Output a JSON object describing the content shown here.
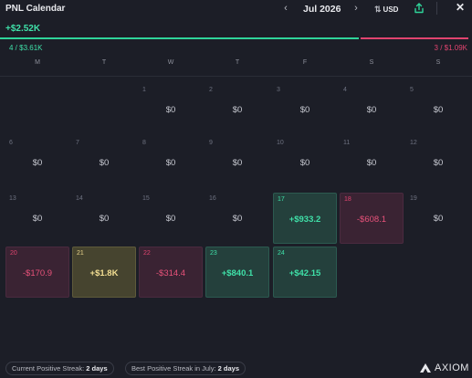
{
  "header": {
    "title": "PNL Calendar",
    "month": "Jul 2026",
    "currency": "USD",
    "prev_icon": "chevron-left-icon",
    "next_icon": "chevron-right-icon",
    "currency_icon": "swap-vertical-icon",
    "share_icon": "share-icon",
    "close_icon": "close-icon"
  },
  "summary": {
    "total": "+$2.52K",
    "wins": "4 / $3.61K",
    "losses": "3 / $1.09K",
    "win_share": 0.768,
    "colors": {
      "positive": "#2fd49a",
      "negative": "#e0446f",
      "highlight": "#f3de92"
    }
  },
  "weekdays": [
    "M",
    "T",
    "W",
    "T",
    "F",
    "S",
    "S"
  ],
  "weeks": [
    [
      {
        "d": "1",
        "v": "$0",
        "s": "zero",
        "c": 2
      },
      {
        "d": "2",
        "v": "$0",
        "s": "zero",
        "c": 3
      },
      {
        "d": "3",
        "v": "$0",
        "s": "zero",
        "c": 4
      },
      {
        "d": "4",
        "v": "$0",
        "s": "zero",
        "c": 5
      },
      {
        "d": "5",
        "v": "$0",
        "s": "zero",
        "c": 6
      }
    ],
    [
      {
        "d": "6",
        "v": "$0",
        "s": "zero",
        "c": 0
      },
      {
        "d": "7",
        "v": "$0",
        "s": "zero",
        "c": 1
      },
      {
        "d": "8",
        "v": "$0",
        "s": "zero",
        "c": 2
      },
      {
        "d": "9",
        "v": "$0",
        "s": "zero",
        "c": 3
      },
      {
        "d": "10",
        "v": "$0",
        "s": "zero",
        "c": 4
      },
      {
        "d": "11",
        "v": "$0",
        "s": "zero",
        "c": 5
      },
      {
        "d": "12",
        "v": "$0",
        "s": "zero",
        "c": 6
      }
    ],
    [
      {
        "d": "13",
        "v": "$0",
        "s": "zero",
        "c": 0
      },
      {
        "d": "14",
        "v": "$0",
        "s": "zero",
        "c": 1
      },
      {
        "d": "15",
        "v": "$0",
        "s": "zero",
        "c": 2
      },
      {
        "d": "16",
        "v": "$0",
        "s": "zero",
        "c": 3
      },
      {
        "d": "17",
        "v": "+$933.2",
        "s": "pos",
        "c": 4
      },
      {
        "d": "18",
        "v": "-$608.1",
        "s": "neg",
        "c": 5
      },
      {
        "d": "19",
        "v": "$0",
        "s": "zero",
        "c": 6
      }
    ],
    [
      {
        "d": "20",
        "v": "-$170.9",
        "s": "neg",
        "c": 0
      },
      {
        "d": "21",
        "v": "+$1.8K",
        "s": "gold",
        "c": 1
      },
      {
        "d": "22",
        "v": "-$314.4",
        "s": "neg",
        "c": 2
      },
      {
        "d": "23",
        "v": "+$840.1",
        "s": "pos",
        "c": 3
      },
      {
        "d": "24",
        "v": "+$42.15",
        "s": "pos",
        "c": 4
      }
    ]
  ],
  "footer": {
    "current_streak_label": "Current Positive Streak:",
    "current_streak_value": "2 days",
    "best_streak_label": "Best Positive Streak in July:",
    "best_streak_value": "2 days",
    "brand": "AXIOM",
    "brand_icon": "axiom-logo-icon"
  }
}
